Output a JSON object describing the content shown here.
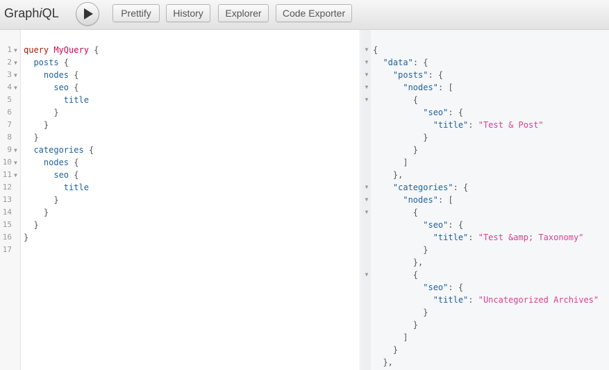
{
  "toolbar": {
    "title_prefix": "Graph",
    "title_italic": "i",
    "title_suffix": "QL",
    "buttons": [
      "Prettify",
      "History",
      "Explorer",
      "Code Exporter"
    ]
  },
  "query": {
    "keyword": "query",
    "operation_name": "MyQuery",
    "fields": {
      "posts": "posts",
      "nodes": "nodes",
      "seo": "seo",
      "title": "title",
      "categories": "categories"
    },
    "line_numbers": [
      "1",
      "2",
      "3",
      "4",
      "5",
      "6",
      "7",
      "8",
      "9",
      "10",
      "11",
      "12",
      "13",
      "14",
      "15",
      "16",
      "17"
    ]
  },
  "result": {
    "keys": {
      "data": "\"data\"",
      "posts": "\"posts\"",
      "nodes": "\"nodes\"",
      "seo": "\"seo\"",
      "title": "\"title\"",
      "categories": "\"categories\""
    },
    "values": {
      "post_title": "\"Test & Post\"",
      "category_title_1": "\"Test &amp; Taxonomy\"",
      "category_title_2": "\"Uncategorized Archives\""
    }
  },
  "colors": {
    "keyword": "#b11a04",
    "operation_name": "#d2054e",
    "field": "#1f61a0",
    "string": "#d64292"
  },
  "icons": {
    "run": "play-icon",
    "fold": "fold-arrow-icon"
  }
}
